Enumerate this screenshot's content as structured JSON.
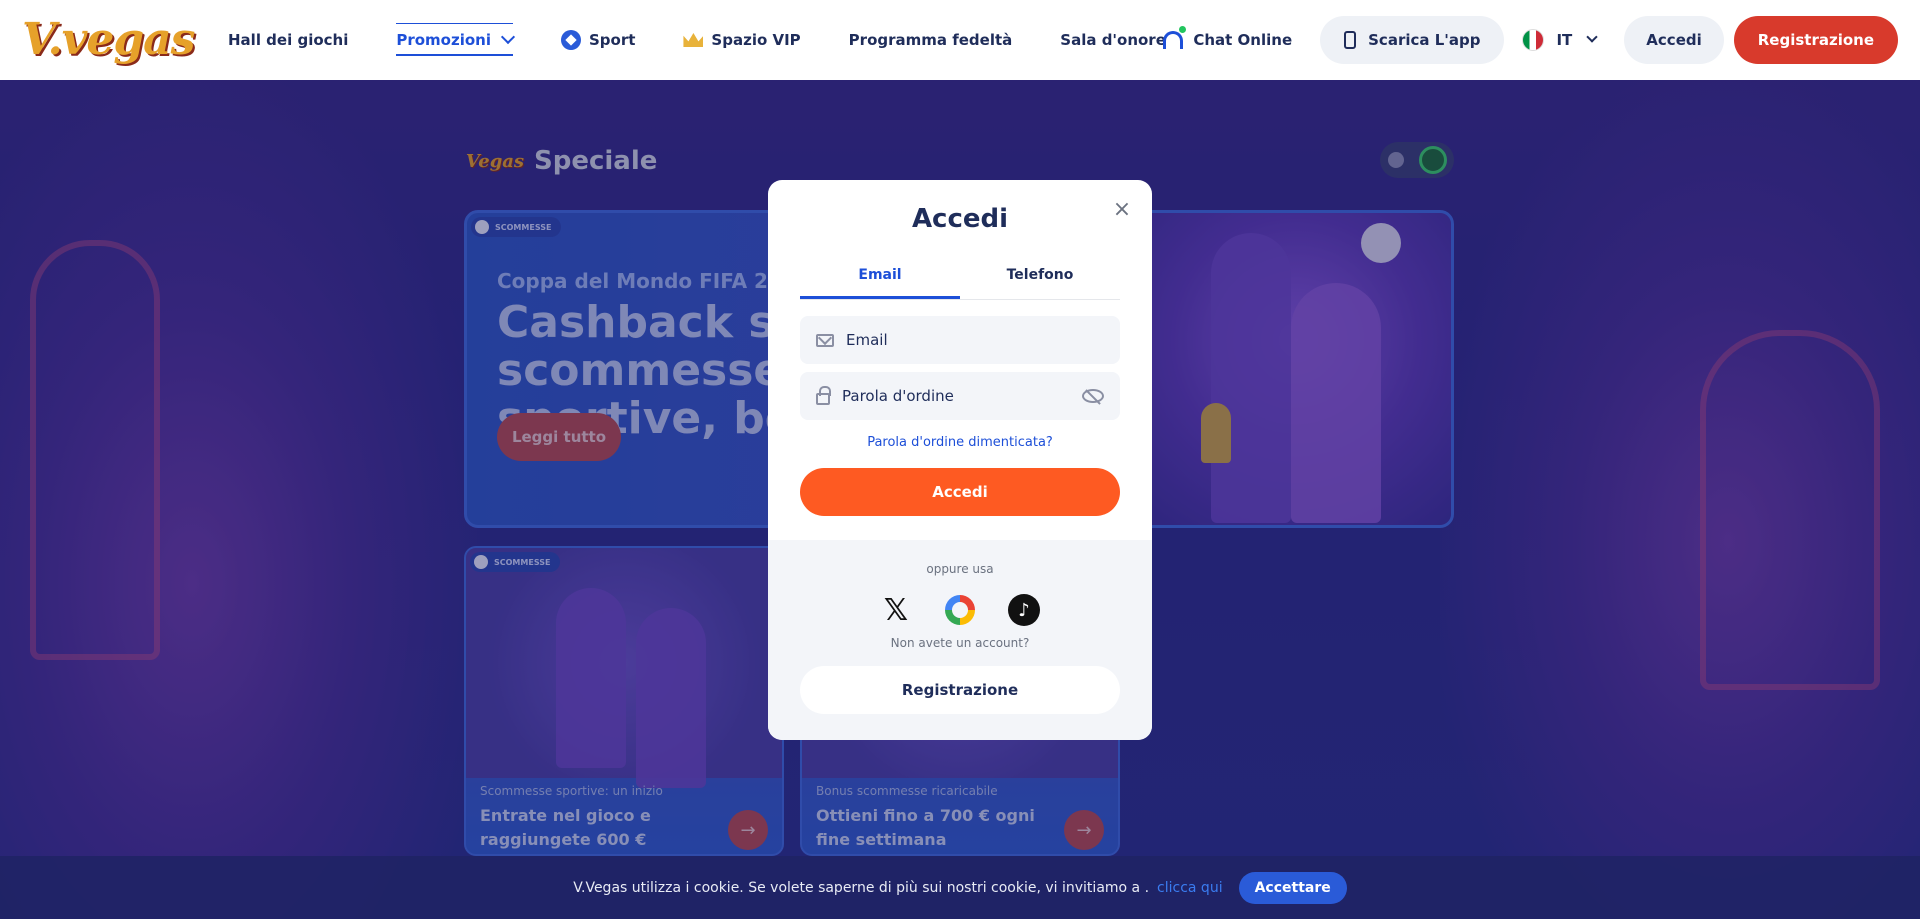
{
  "header": {
    "logo_text": "V.vegas",
    "nav": [
      {
        "label": "Hall dei giochi"
      },
      {
        "label": "Promozioni"
      },
      {
        "label": "Sport"
      },
      {
        "label": "Spazio VIP"
      },
      {
        "label": "Programma fedeltà"
      },
      {
        "label": "Sala d'onore"
      }
    ],
    "chat_label": "Chat Online",
    "app_label": "Scarica L'app",
    "lang_label": "IT",
    "login_label": "Accedi",
    "register_label": "Registrazione"
  },
  "content": {
    "section_title": "Speciale",
    "mini_logo": "Vegas",
    "hero": {
      "tag": "SCOMMESSE",
      "subtitle": "Coppa del Mondo FIFA 2026",
      "title": "Cashback sulle scommesse sportive, bonus",
      "button": "Leggi tutto"
    },
    "cards": [
      {
        "tag": "SCOMMESSE",
        "subtitle": "Scommesse sportive: un inizio",
        "title": "Entrate nel gioco e raggiungete 600 €"
      },
      {
        "tag": "",
        "subtitle": "Bonus scommesse ricaricabile",
        "title": "Ottieni fino a 700 € ogni fine settimana"
      }
    ]
  },
  "modal": {
    "title": "Accedi",
    "tabs": [
      {
        "label": "Email"
      },
      {
        "label": "Telefono"
      }
    ],
    "email_placeholder": "Email",
    "password_placeholder": "Parola d'ordine",
    "forgot": "Parola d'ordine dimenticata?",
    "submit": "Accedi",
    "or_use": "oppure usa",
    "no_account": "Non avete un account?",
    "register": "Registrazione"
  },
  "cookie": {
    "text": "V.Vegas utilizza i cookie. Se volete saperne di più sui nostri cookie, vi invitiamo a .",
    "link": "clicca qui",
    "accept": "Accettare"
  },
  "colors": {
    "accent": "#1d4fd8",
    "primary_button": "#fe5a22",
    "register_button": "#d83a2c"
  }
}
